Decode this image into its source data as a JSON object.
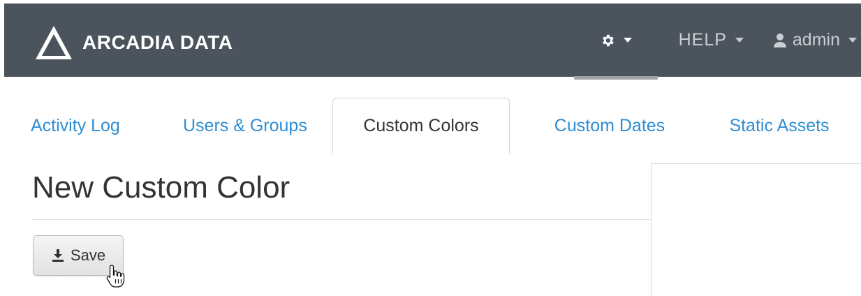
{
  "header": {
    "brand_name": "ARCADIA DATA",
    "logo_icon": "triangle-logo-icon",
    "settings_icon": "gear-icon",
    "help_label": "HELP",
    "user_icon": "user-icon",
    "user_label": "admin",
    "background_color": "#4b545c"
  },
  "tabs": [
    {
      "label": "Activity Log",
      "active": false
    },
    {
      "label": "Users & Groups",
      "active": false
    },
    {
      "label": "Custom Colors",
      "active": true
    },
    {
      "label": "Custom Dates",
      "active": false
    },
    {
      "label": "Static Assets",
      "active": false
    }
  ],
  "main": {
    "title": "New Custom Color",
    "save_label": "Save",
    "save_icon": "download-icon",
    "link_color": "#2f8dd3"
  }
}
